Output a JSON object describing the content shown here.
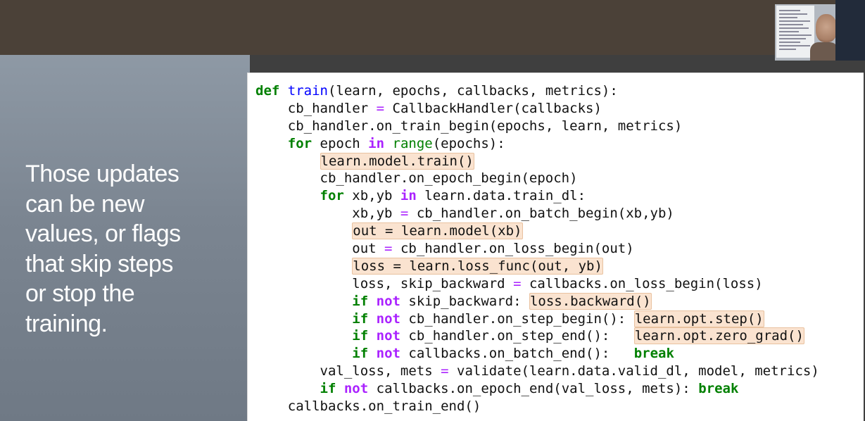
{
  "slide": {
    "text_lines": [
      "Those updates",
      "can be new",
      "values, or flags",
      "that skip steps",
      "or stop the",
      "training."
    ]
  },
  "code": {
    "lines": [
      {
        "indent": "",
        "segments": [
          {
            "t": "def",
            "c": "kw"
          },
          {
            "t": " "
          },
          {
            "t": "train",
            "c": "fn"
          },
          {
            "t": "(learn, epochs, callbacks, metrics):"
          }
        ]
      },
      {
        "indent": "    ",
        "segments": [
          {
            "t": "cb_handler "
          },
          {
            "t": "=",
            "c": "op"
          },
          {
            "t": " CallbackHandler(callbacks)"
          }
        ]
      },
      {
        "indent": "    ",
        "segments": [
          {
            "t": "cb_handler.on_train_begin(epochs, learn, metrics)"
          }
        ]
      },
      {
        "indent": "    ",
        "segments": [
          {
            "t": "for",
            "c": "kw"
          },
          {
            "t": " epoch "
          },
          {
            "t": "in",
            "c": "kw2"
          },
          {
            "t": " "
          },
          {
            "t": "range",
            "c": "bi"
          },
          {
            "t": "(epochs):"
          }
        ]
      },
      {
        "indent": "        ",
        "segments": [
          {
            "t": "learn.model.train()",
            "c": "hl"
          }
        ]
      },
      {
        "indent": "        ",
        "segments": [
          {
            "t": "cb_handler.on_epoch_begin(epoch)"
          }
        ]
      },
      {
        "indent": "        ",
        "segments": [
          {
            "t": "for",
            "c": "kw"
          },
          {
            "t": " xb,yb "
          },
          {
            "t": "in",
            "c": "kw2"
          },
          {
            "t": " learn.data.train_dl:"
          }
        ]
      },
      {
        "indent": "            ",
        "segments": [
          {
            "t": "xb,yb "
          },
          {
            "t": "=",
            "c": "op"
          },
          {
            "t": " cb_handler.on_batch_begin(xb,yb)"
          }
        ]
      },
      {
        "indent": "            ",
        "segments": [
          {
            "t": "out = learn.model(xb)",
            "c": "hl"
          }
        ]
      },
      {
        "indent": "            ",
        "segments": [
          {
            "t": "out "
          },
          {
            "t": "=",
            "c": "op"
          },
          {
            "t": " cb_handler.on_loss_begin(out)"
          }
        ]
      },
      {
        "indent": "            ",
        "segments": [
          {
            "t": "loss = learn.loss_func(out, yb)",
            "c": "hl"
          }
        ]
      },
      {
        "indent": "            ",
        "segments": [
          {
            "t": "loss, skip_backward "
          },
          {
            "t": "=",
            "c": "op"
          },
          {
            "t": " callbacks.on_loss_begin(loss)"
          }
        ]
      },
      {
        "indent": "            ",
        "segments": [
          {
            "t": "if",
            "c": "kw"
          },
          {
            "t": " "
          },
          {
            "t": "not",
            "c": "kw2"
          },
          {
            "t": " skip_backward: "
          },
          {
            "t": "loss.backward()",
            "c": "hl"
          }
        ]
      },
      {
        "indent": "            ",
        "segments": [
          {
            "t": "if",
            "c": "kw"
          },
          {
            "t": " "
          },
          {
            "t": "not",
            "c": "kw2"
          },
          {
            "t": " cb_handler.on_step_begin(): "
          },
          {
            "t": "learn.opt.step()",
            "c": "hl"
          }
        ]
      },
      {
        "indent": "            ",
        "segments": [
          {
            "t": "if",
            "c": "kw"
          },
          {
            "t": " "
          },
          {
            "t": "not",
            "c": "kw2"
          },
          {
            "t": " cb_handler.on_step_end():   "
          },
          {
            "t": "learn.opt.zero_grad()",
            "c": "hl"
          }
        ]
      },
      {
        "indent": "            ",
        "segments": [
          {
            "t": "if",
            "c": "kw"
          },
          {
            "t": " "
          },
          {
            "t": "not",
            "c": "kw2"
          },
          {
            "t": " callbacks.on_batch_end():   "
          },
          {
            "t": "break",
            "c": "kw"
          }
        ]
      },
      {
        "indent": "        ",
        "segments": [
          {
            "t": "val_loss, mets "
          },
          {
            "t": "=",
            "c": "op"
          },
          {
            "t": " validate(learn.data.valid_dl, model, metrics)"
          }
        ]
      },
      {
        "indent": "        ",
        "segments": [
          {
            "t": "if",
            "c": "kw"
          },
          {
            "t": " "
          },
          {
            "t": "not",
            "c": "kw2"
          },
          {
            "t": " callbacks.on_epoch_end(val_loss, mets): "
          },
          {
            "t": "break",
            "c": "kw"
          }
        ]
      },
      {
        "indent": "    ",
        "segments": [
          {
            "t": "callbacks.on_train_end()"
          }
        ]
      }
    ]
  },
  "colors": {
    "keyword": "#008000",
    "operator": "#aa22ff",
    "function_name": "#0000ff",
    "highlight": "#fae3d0",
    "slide_panel": "#7b8591",
    "top_band": "#4b4138"
  },
  "icons": {
    "webcam": "presenter-webcam-icon"
  }
}
